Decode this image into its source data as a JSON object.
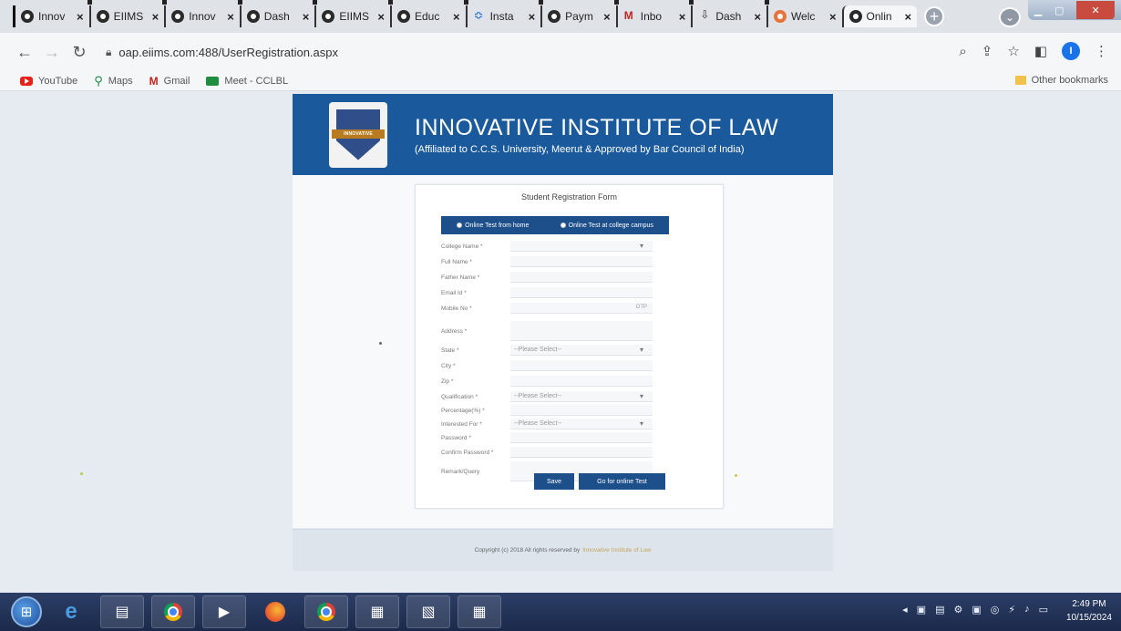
{
  "tabs": [
    {
      "label": "Innov",
      "icon": "globe-icon"
    },
    {
      "label": "EIIMS",
      "icon": "globe-icon"
    },
    {
      "label": "Innov",
      "icon": "globe-icon"
    },
    {
      "label": "Dash",
      "icon": "globe-icon"
    },
    {
      "label": "EIIMS",
      "icon": "globe-icon"
    },
    {
      "label": "Educ",
      "icon": "globe-icon"
    },
    {
      "label": "Insta",
      "icon": "sync-icon"
    },
    {
      "label": "Paym",
      "icon": "globe-icon"
    },
    {
      "label": "Inbo",
      "icon": "gmail-icon"
    },
    {
      "label": "Dash",
      "icon": "download-icon"
    },
    {
      "label": "Welc",
      "icon": "orange-icon"
    },
    {
      "label": "Onlin",
      "icon": "globe-icon"
    }
  ],
  "address": {
    "url": "oap.eiims.com:488/UserRegistration.aspx"
  },
  "bookmarks": [
    {
      "label": "YouTube",
      "icon": "youtube-icon"
    },
    {
      "label": "Maps",
      "icon": "maps-icon"
    },
    {
      "label": "Gmail",
      "icon": "gmail-icon"
    },
    {
      "label": "Meet - CCLBL",
      "icon": "meet-icon"
    }
  ],
  "other_bookmarks": "Other bookmarks",
  "banner": {
    "title": "INNOVATIVE INSTITUTE OF LAW",
    "subtitle": "(Affiliated to C.C.S. University, Meerut & Approved by Bar Council of India)",
    "logo_text": "INNOVATIVE"
  },
  "form": {
    "title": "Student Registration Form",
    "radio_home": "Online Test from home",
    "radio_campus": "Online Test at college campus",
    "fields": {
      "college": "College Name *",
      "fullname": "Full Name *",
      "father": "Father Name *",
      "email": "Email Id *",
      "mobile": "Mobile No *",
      "otp": "OTP",
      "address": "Address *",
      "state": "State *",
      "state_value": "--Please Select--",
      "city": "City *",
      "zip": "Zip *",
      "qualification": "Qualification *",
      "qualification_value": "--Please Select--",
      "percentage": "Percentage(%) *",
      "interested": "Interested For *",
      "interested_value": "--Please Select--",
      "password": "Password *",
      "confirm": "Confirm Password *",
      "remark": "Remark/Query"
    },
    "save_label": "Save",
    "online_label": "Go for online Test"
  },
  "footer": {
    "text": "Copyright (c) 2018 All rights reserved by",
    "link": "Innovative Institute of Law"
  },
  "taskbar": {
    "time": "2:49 PM",
    "date": "10/15/2024"
  },
  "colors": {
    "banner": "#1a5a9c",
    "accent": "#1d4f8a"
  }
}
